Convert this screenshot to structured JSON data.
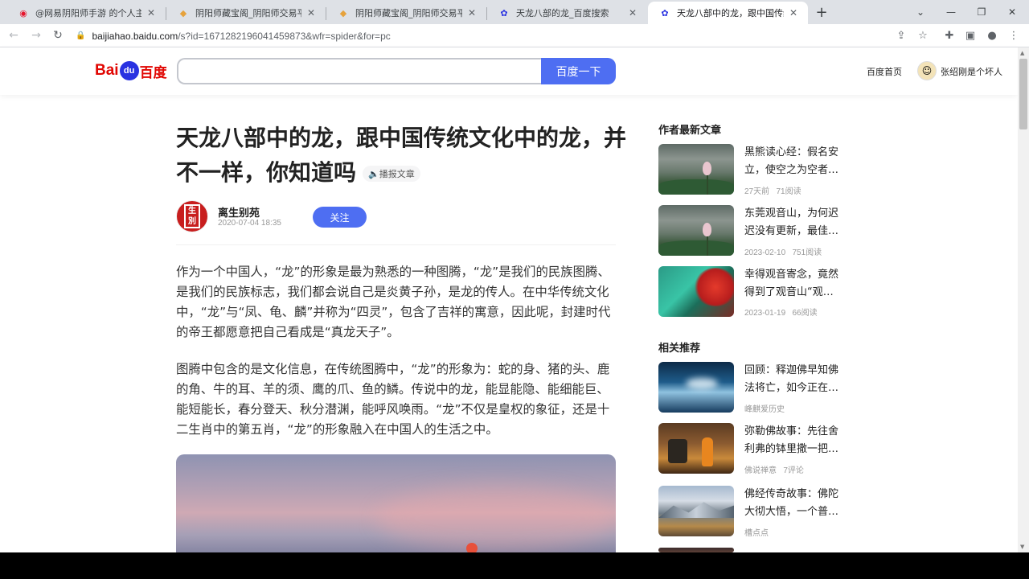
{
  "browser": {
    "tabs": [
      {
        "label": "@网易阴阳师手游 的个人主页 -",
        "icon": "weibo-icon",
        "active": false
      },
      {
        "label": "阴阳师藏宝阁_阴阳师交易平台官",
        "icon": "treasure-icon",
        "active": false
      },
      {
        "label": "阴阳师藏宝阁_阴阳师交易平台官",
        "icon": "treasure-icon",
        "active": false
      },
      {
        "label": "天龙八部的龙_百度搜索",
        "icon": "baidu-paw-icon",
        "active": false
      },
      {
        "label": "天龙八部中的龙，跟中国传统文化",
        "icon": "baidu-paw-icon",
        "active": true
      }
    ],
    "url_host": "baijiahao.baidu.com",
    "url_path": "/s?id=1671282196041459873&wfr=spider&for=pc"
  },
  "header": {
    "logo_bai": "Bai",
    "logo_du": "du",
    "logo_cn": "百度",
    "search_value": "",
    "search_button": "百度一下",
    "home_link": "百度首页",
    "username": "张绍刚是个坏人"
  },
  "article": {
    "title": "天龙八部中的龙，跟中国传统文化中的龙，并不一样，你知道吗",
    "listen_label": "播报文章",
    "author_name": "离生别苑",
    "author_seal": "离生别苑",
    "publish_time": "2020-07-04 18:35",
    "follow_label": "关注",
    "paragraphs": [
      "作为一个中国人，“龙”的形象是最为熟悉的一种图腾，“龙”是我们的民族图腾、是我们的民族标志，我们都会说自己是炎黄子孙，是龙的传人。在中华传统文化中，“龙”与“凤、龟、麟”并称为“四灵”，包含了吉祥的寓意，因此呢，封建时代的帝王都愿意把自己看成是“真龙天子”。",
      "图腾中包含的是文化信息，在传统图腾中，“龙”的形象为：蛇的身、猪的头、鹿的角、牛的耳、羊的须、鹰的爪、鱼的鳞。传说中的龙，能显能隐、能细能巨、能短能长，春分登天、秋分潜渊，能呼风唤雨。“龙”不仅是皇权的象征，还是十二生肖中的第五肖，“龙”的形象融入在中国人的生活之中。"
    ]
  },
  "sidebar": {
    "latest_heading": "作者最新文章",
    "latest": [
      {
        "title": "黑熊读心经：假名安立，使空之为空者…",
        "meta_time": "27天前",
        "meta_reads": "71阅读",
        "image": "lotus"
      },
      {
        "title": "东莞观音山，为何迟迟没有更新，最佳…",
        "meta_time": "2023-02-10",
        "meta_reads": "751阅读",
        "image": "lotus"
      },
      {
        "title": "幸得观音寄念，竟然得到了观音山“观…",
        "meta_time": "2023-01-19",
        "meta_reads": "66阅读",
        "image": "valley"
      }
    ],
    "related_heading": "相关推荐",
    "related": [
      {
        "title": "回顾：释迦佛早知佛法将亡，如今正在…",
        "meta_source": "峰麒爱历史",
        "meta_extra": "",
        "image": "ice"
      },
      {
        "title": "弥勒佛故事：先往舍利弗的钵里撒一把…",
        "meta_source": "佛说禅意",
        "meta_extra": "7评论",
        "image": "monk"
      },
      {
        "title": "佛经传奇故事：佛陀大彻大悟，一个普…",
        "meta_source": "槽点点",
        "meta_extra": "",
        "image": "mountain"
      }
    ]
  }
}
